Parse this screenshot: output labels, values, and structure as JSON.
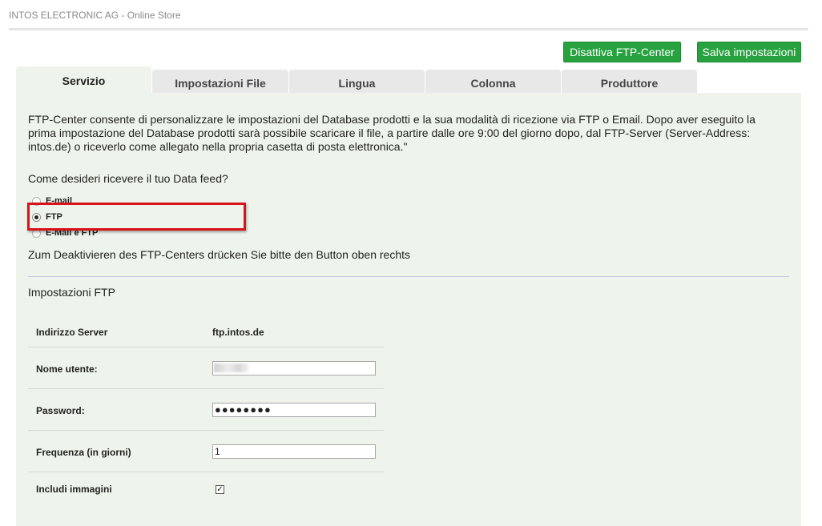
{
  "header": {
    "store_title": "INTOS ELECTRONIC AG - Online Store"
  },
  "toolbar": {
    "disable_label": "Disattiva FTP-Center",
    "save_label": "Salva impostazioni"
  },
  "tabs": [
    {
      "label": "Servizio",
      "active": true
    },
    {
      "label": "Impostazioni File",
      "active": false
    },
    {
      "label": "Lingua",
      "active": false
    },
    {
      "label": "Colonna",
      "active": false
    },
    {
      "label": "Produttore",
      "active": false
    }
  ],
  "service": {
    "intro": "FTP-Center consente di personalizzare le impostazioni del Database prodotti e la sua modalità di ricezione via FTP o Email. Dopo aver eseguito la prima impostazione del Database prodotti sarà possibile scaricare il file, a partire dalle ore 9:00 del giorno dopo, dal FTP-Server (Server-Address: intos.de) o riceverlo come allegato nella propria casetta di posta elettronica.\"",
    "question": "Come desideri ricevere il tuo Data feed?",
    "options": [
      {
        "label": "E-mail",
        "checked": false
      },
      {
        "label": "FTP",
        "checked": true
      },
      {
        "label": "E-Mail e FTP",
        "checked": false
      }
    ],
    "deactivate_note": "Zum Deaktivieren des FTP-Centers drücken Sie bitte den Button oben rechts"
  },
  "ftp_settings": {
    "title": "Impostazioni FTP",
    "server_label": "Indirizzo Server",
    "server_value": "ftp.intos.de",
    "username_label": "Nome utente:",
    "username_value": "",
    "password_label": "Password:",
    "password_value": "●●●●●●●●",
    "frequency_label": "Frequenza (in giorni)",
    "frequency_value": "1",
    "images_label": "Includi immagini",
    "images_checked": true,
    "images_check_glyph": "✓"
  },
  "colors": {
    "button_green": "#27a23f",
    "panel_bg": "#eef4eb",
    "highlight_red": "#d8141a"
  }
}
